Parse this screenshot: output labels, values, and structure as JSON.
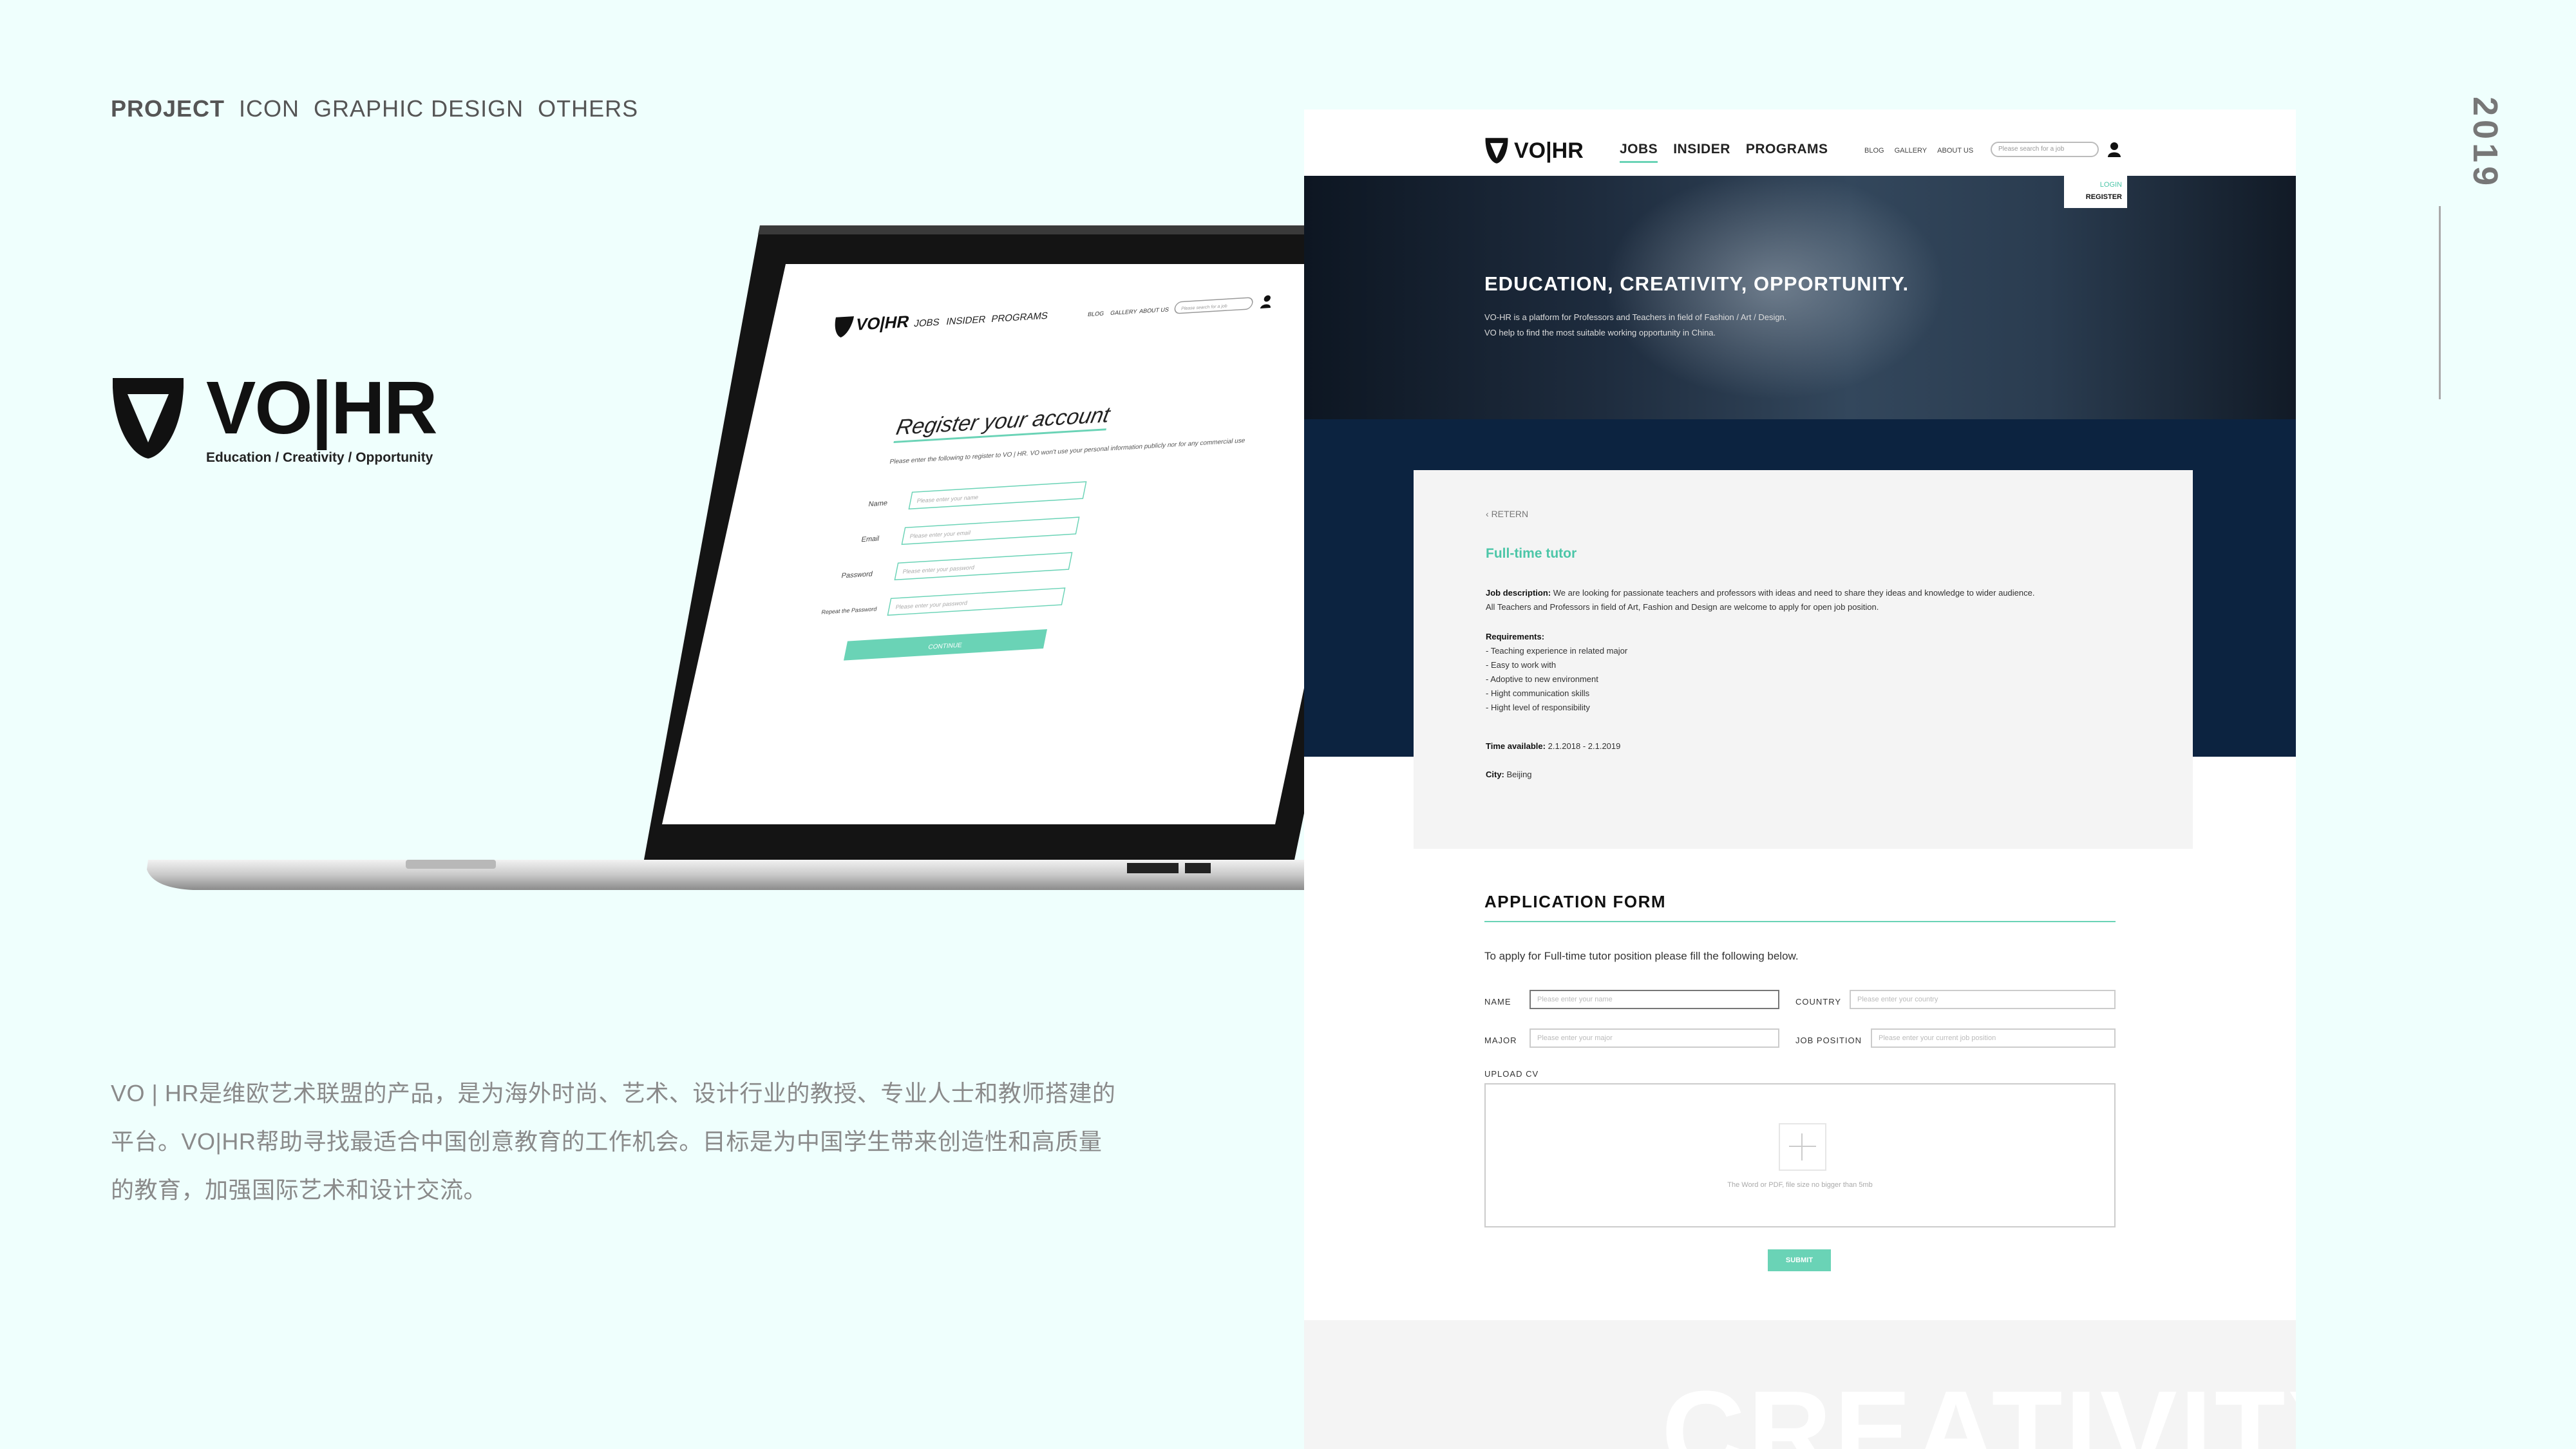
{
  "nav": {
    "items": [
      {
        "label": "PROJECT",
        "active": true
      },
      {
        "label": "ICON",
        "active": false
      },
      {
        "label": "GRAPHIC DESIGN",
        "active": false
      },
      {
        "label": "OTHERS",
        "active": false
      }
    ]
  },
  "year": "2019",
  "brand": {
    "name": "VO|HR",
    "tagline": "Education / Creativity / Opportunity"
  },
  "description": {
    "lines": [
      "VO | HR是维欧艺术联盟的产品，是为海外时尚、艺术、设计行业的教授、专业人士和教师搭建的",
      "平台。VO|HR帮助寻找最适合中国创意教育的工作机会。目标是为中国学生带来创造性和高质量",
      "的教育，加强国际艺术和设计交流。"
    ]
  },
  "laptop": {
    "nav_links": [
      "JOBS",
      "INSIDER",
      "PROGRAMS"
    ],
    "nav_small": [
      "BLOG",
      "GALLERY",
      "ABOUT US"
    ],
    "search_placeholder": "Please search for a job",
    "heading": "Register your account",
    "intro": "Please enter the following to register to VO | HR. VO won't use your personal information publicly nor for any commercial use",
    "fields": [
      {
        "label": "Name",
        "placeholder": "Please enter your name"
      },
      {
        "label": "Email",
        "placeholder": "Please enter your email"
      },
      {
        "label": "Password",
        "placeholder": "Please enter your password"
      },
      {
        "label": "Repeat the Password",
        "placeholder": "Please enter your password"
      }
    ],
    "continue_label": "CONTINUE"
  },
  "site": {
    "nav_links": [
      "JOBS",
      "INSIDER",
      "PROGRAMS"
    ],
    "nav_small": [
      "BLOG",
      "GALLERY",
      "ABOUT US"
    ],
    "search_placeholder": "Please search for a job",
    "login_label": "LOGIN",
    "register_label": "REGISTER",
    "hero_title": "EDUCATION, CREATIVITY, OPPORTUNITY.",
    "hero_line1": "VO-HR is a platform for Professors and Teachers in field of Fashion / Art / Design.",
    "hero_line2": "VO help to find the most suitable working opportunity in China.",
    "job": {
      "return_label": "RETERN",
      "title": "Full-time tutor",
      "desc_label": "Job description:",
      "desc_text": "We are looking for passionate teachers and professors with ideas and need to share they ideas and knowledge to wider audience.",
      "desc_text2": "All Teachers and Professors in field of Art, Fashion and Design are welcome to apply for open job position.",
      "req_label": "Requirements:",
      "requirements": [
        "- Teaching experience in related major",
        "- Easy to work with",
        "- Adoptive to new environment",
        "- Hight communication skills",
        "- Hight level of responsibility"
      ],
      "time_label": "Time available:",
      "time_value": "2.1.2018 - 2.1.2019",
      "city_label": "City:",
      "city_value": "Beijing"
    },
    "form": {
      "title": "APPLICATION FORM",
      "intro": "To apply for Full-time tutor position please fill the following below.",
      "name_label": "NAME",
      "name_placeholder": "Please enter your name",
      "country_label": "COUNTRY",
      "country_placeholder": "Please enter your country",
      "major_label": "MAJOR",
      "major_placeholder": "Please enter your major",
      "position_label": "JOB POSITION",
      "position_placeholder": "Please enter your current job position",
      "upload_label": "UPLOAD CV",
      "upload_hint": "The Word or PDF, file size no bigger than 5mb",
      "submit_label": "SUBMIT"
    },
    "bottom_word": "CREATIVITY"
  },
  "colors": {
    "background": "#effffd",
    "accent": "#6ad3b6",
    "navy": "#0c2340"
  }
}
